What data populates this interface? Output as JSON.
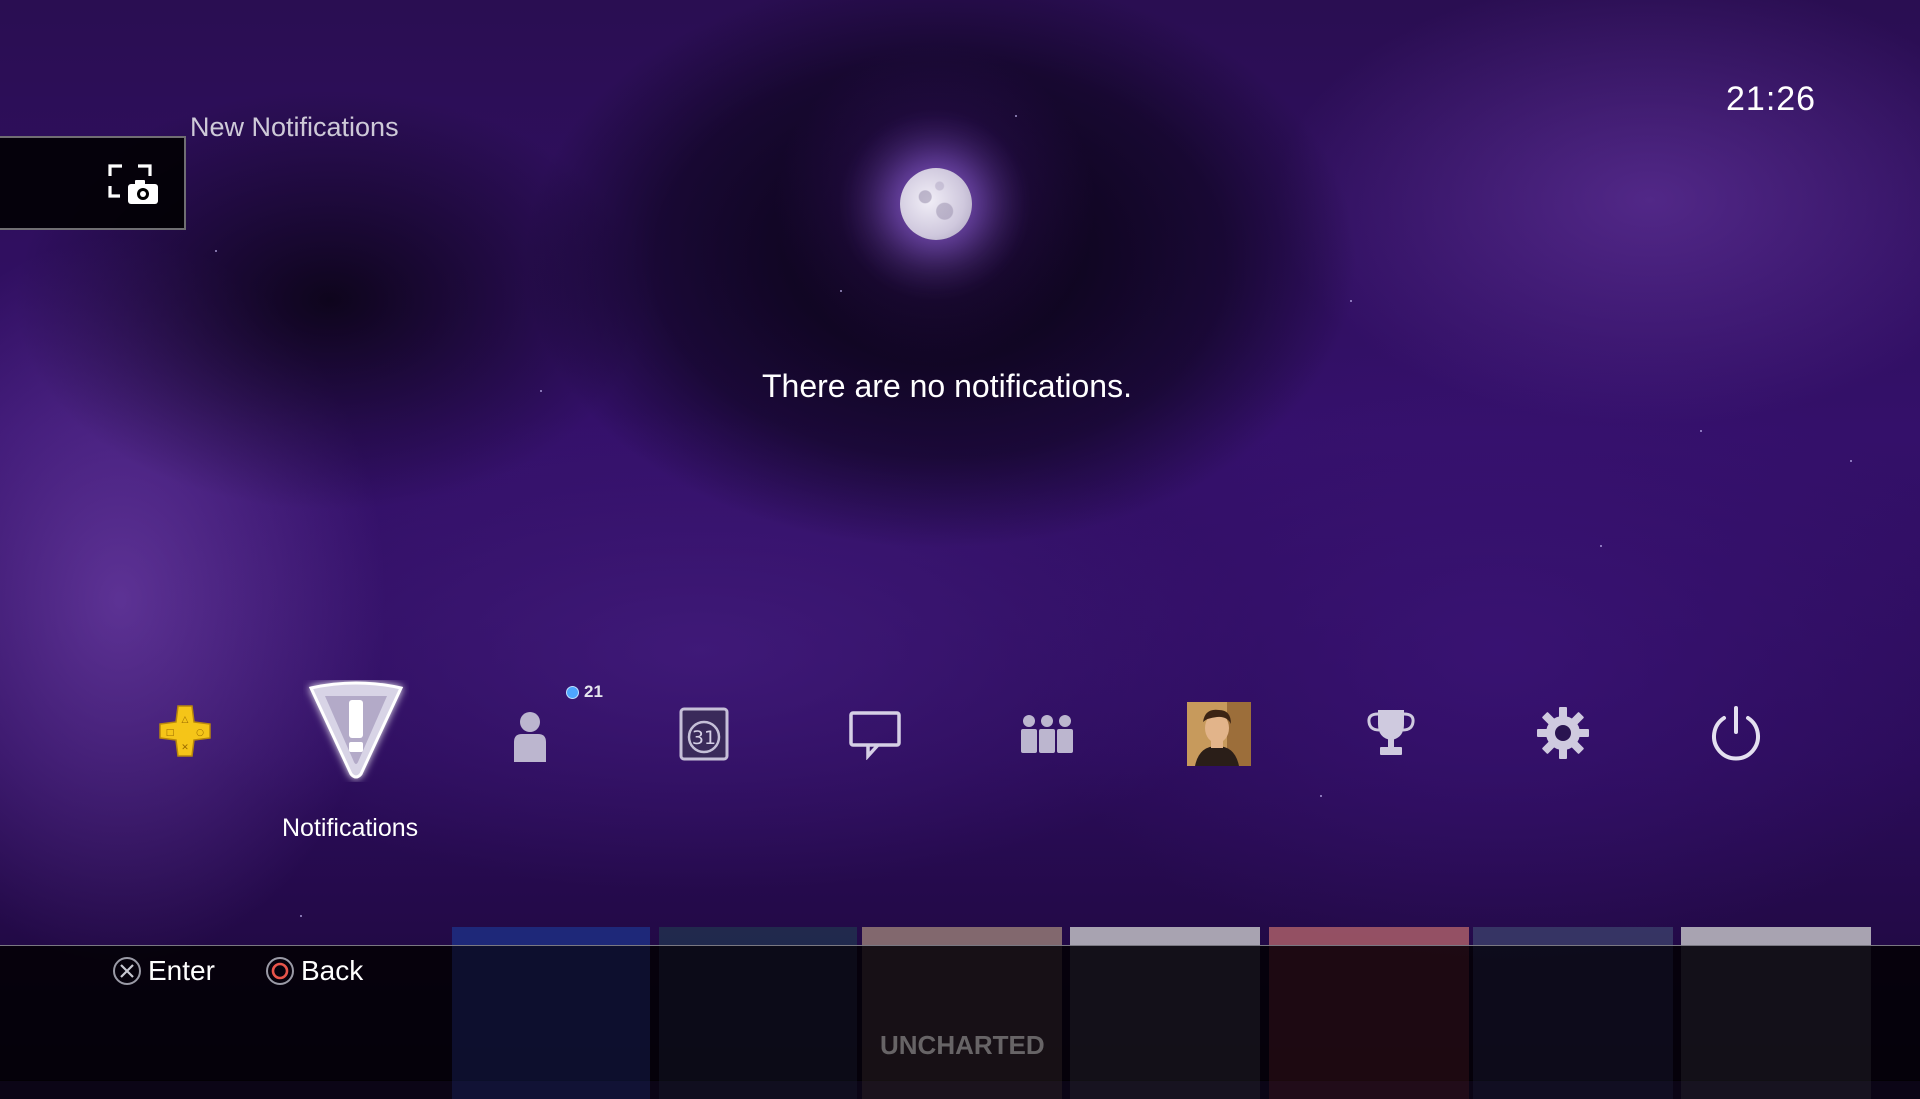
{
  "header": {
    "section_title": "New Notifications",
    "clock": "21:26"
  },
  "capture_panel": {
    "icon": "screenshot-capture-icon"
  },
  "main": {
    "empty_message": "There are no notifications."
  },
  "function_bar": {
    "selected_label": "Notifications",
    "items": [
      {
        "name": "playstation-plus",
        "icon": "ps-plus-icon"
      },
      {
        "name": "notifications",
        "icon": "notifications-icon"
      },
      {
        "name": "friends",
        "icon": "friends-icon",
        "badge": "21"
      },
      {
        "name": "events",
        "icon": "calendar-icon",
        "calendar_day": "31"
      },
      {
        "name": "messages",
        "icon": "message-icon"
      },
      {
        "name": "party",
        "icon": "party-icon"
      },
      {
        "name": "profile",
        "icon": "avatar"
      },
      {
        "name": "trophies",
        "icon": "trophy-icon"
      },
      {
        "name": "settings",
        "icon": "gear-icon"
      },
      {
        "name": "power",
        "icon": "power-icon"
      }
    ]
  },
  "content_strip": {
    "visible_title": "UNCHARTED"
  },
  "footer": {
    "enter_label": "Enter",
    "back_label": "Back"
  },
  "colors": {
    "ps_plus_yellow": "#f5c518",
    "badge_blue": "#4ea6ff",
    "circle_button_red": "#e8544a",
    "background_purple": "#2a0e52"
  }
}
